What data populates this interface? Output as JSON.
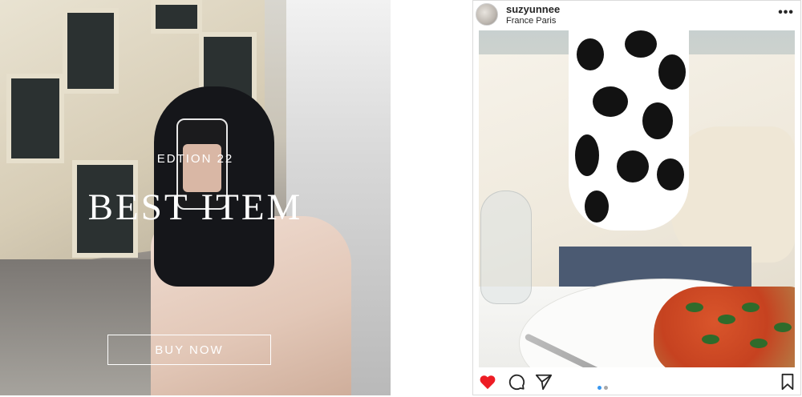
{
  "promo": {
    "edition": "EDTION 22",
    "headline": "BEST ITEM",
    "button_label": "BUY NOW"
  },
  "post": {
    "username": "suzyunnee",
    "location": "France Paris",
    "more_label": "•••",
    "carousel": {
      "current": 1,
      "total": 2
    },
    "icons": [
      "heart-icon",
      "comment-icon",
      "share-icon",
      "bookmark-icon"
    ],
    "colors": {
      "like": "#ed1c24",
      "dot_active": "#3897f0",
      "dot_inactive": "#a8a8a8"
    }
  }
}
